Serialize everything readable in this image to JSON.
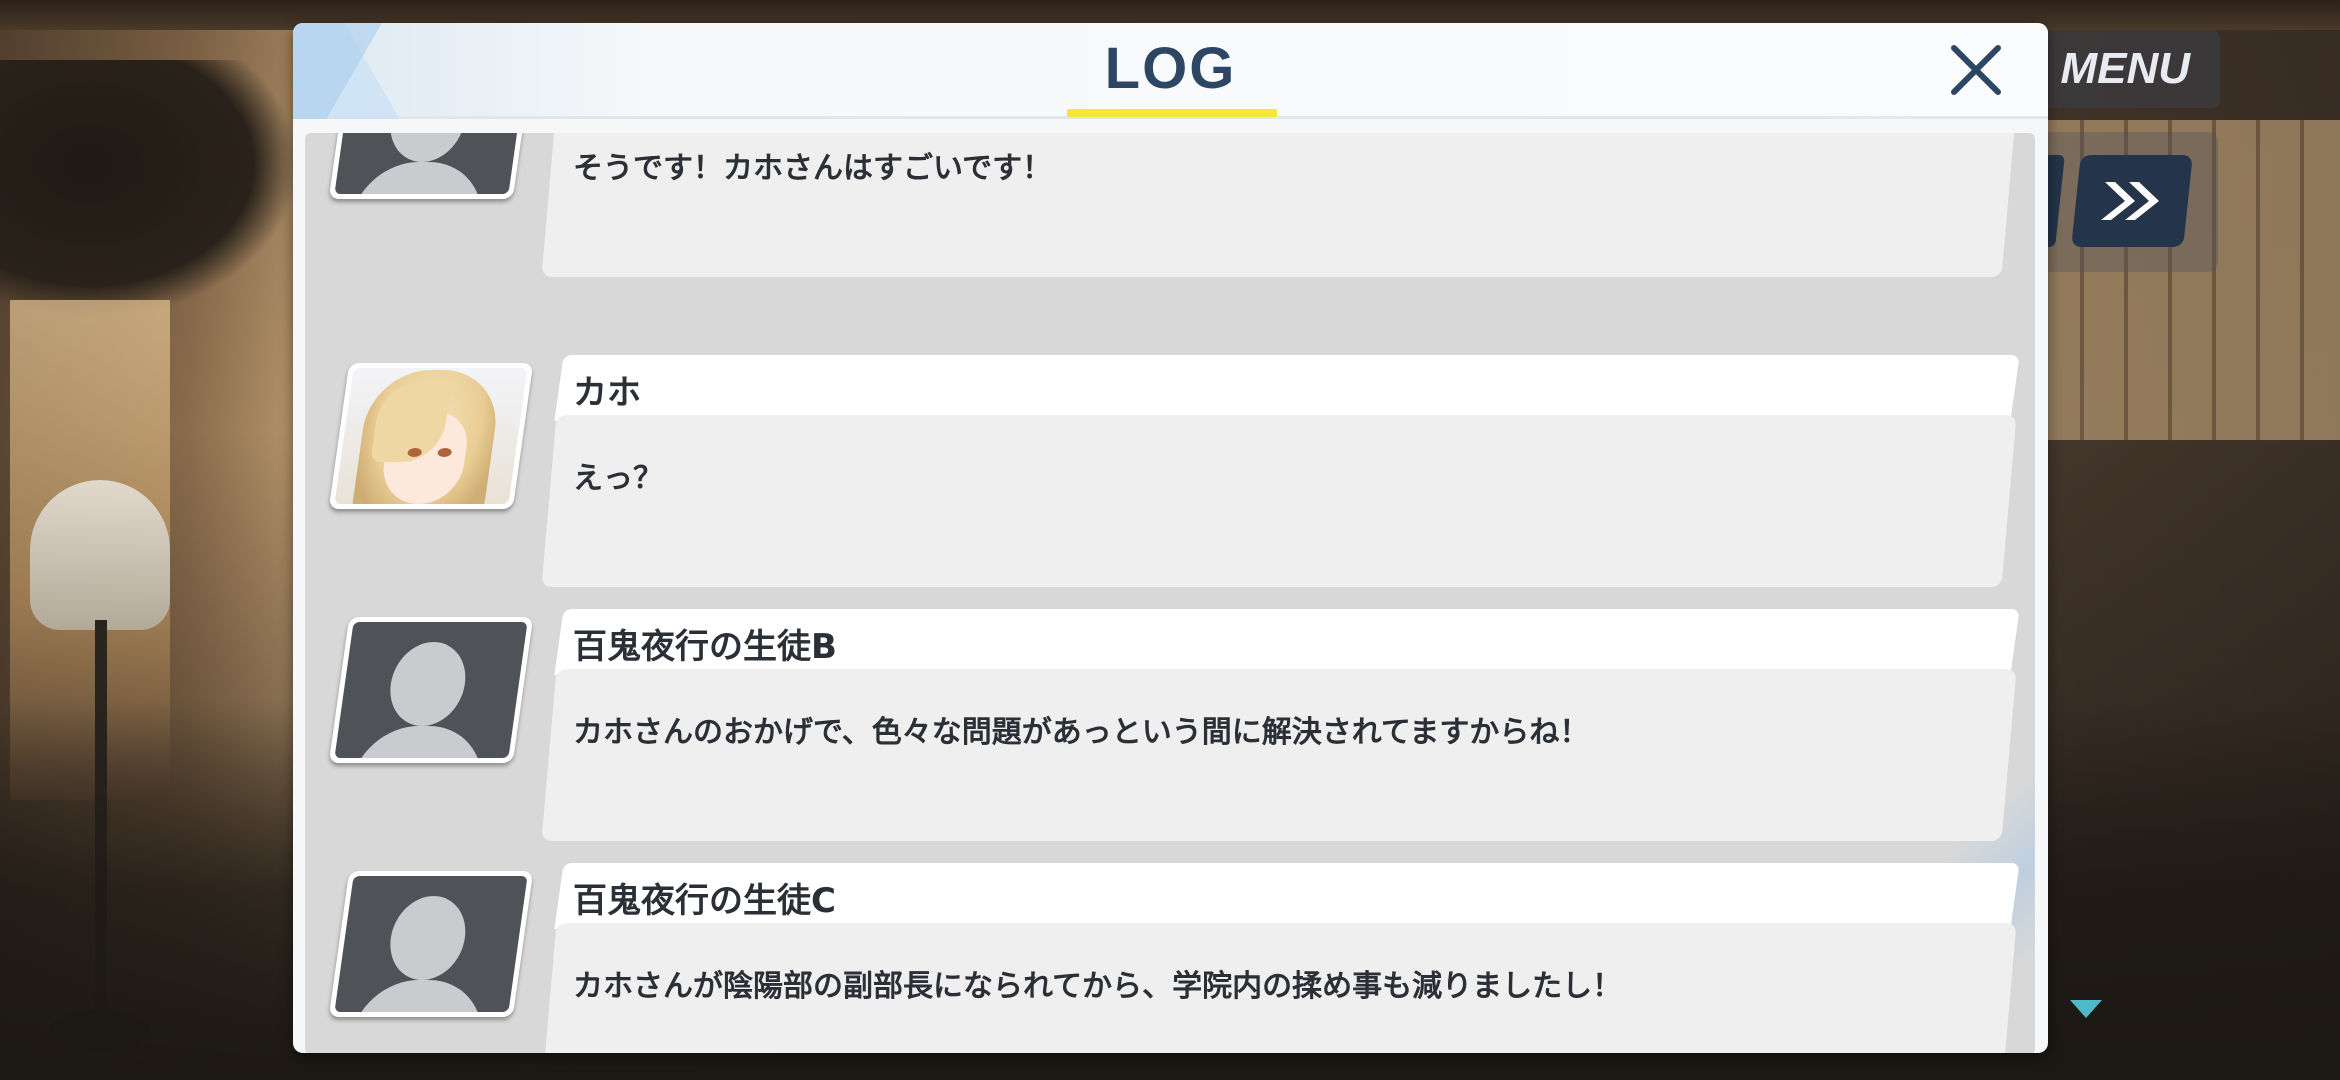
{
  "dialog": {
    "title": "LOG",
    "close_icon": "close-icon",
    "accent_color": "#f5e63a",
    "title_color": "#2d4664"
  },
  "hud": {
    "menu_label": "MENU",
    "fast_forward_icon": "fast-forward-icon",
    "scroll_indicator_icon": "triangle-down-icon"
  },
  "log": {
    "entries": [
      {
        "speaker": "",
        "avatar": "placeholder-avatar",
        "message": "そうです！カホさんはすごいです！"
      },
      {
        "speaker": "カホ",
        "avatar": "kaho-portrait",
        "message": "えっ？"
      },
      {
        "speaker": "百鬼夜行の生徒B",
        "avatar": "placeholder-avatar",
        "message": "カホさんのおかげで、色々な問題があっという間に解決されてますからね！"
      },
      {
        "speaker": "百鬼夜行の生徒C",
        "avatar": "placeholder-avatar",
        "message": "カホさんが陰陽部の副部長になられてから、学院内の揉め事も減りましたし！"
      }
    ]
  }
}
